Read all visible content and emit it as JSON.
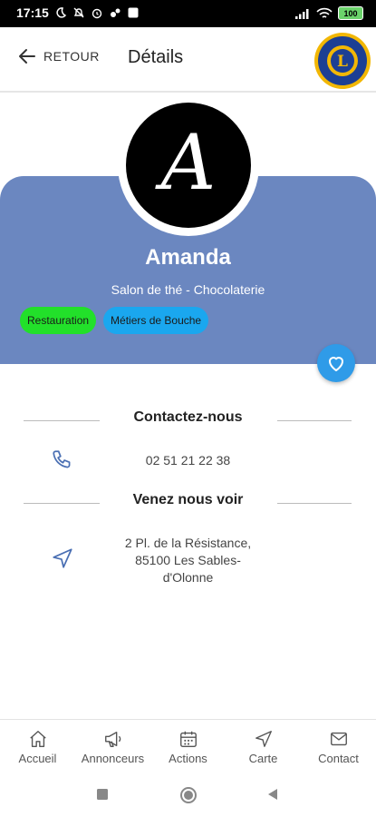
{
  "status_bar": {
    "time": "17:15",
    "battery": "100"
  },
  "header": {
    "back_label": "RETOUR",
    "title": "Détails"
  },
  "profile": {
    "avatar_letter": "A",
    "name": "Amanda",
    "subtitle": "Salon de thé - Chocolaterie",
    "tags": [
      {
        "label": "Restauration",
        "color": "#22e02a"
      },
      {
        "label": "Métiers de Bouche",
        "color": "#1aa7ef"
      }
    ]
  },
  "contact": {
    "title": "Contactez-nous",
    "phone": "02 51 21 22 38"
  },
  "visit": {
    "title": "Venez nous voir",
    "address_line1": "2 Pl. de la Résistance,",
    "address_line2": "85100 Les Sables-",
    "address_line3": "d'Olonne"
  },
  "nav": {
    "items": [
      {
        "label": "Accueil",
        "icon": "home-icon"
      },
      {
        "label": "Annonceurs",
        "icon": "megaphone-icon"
      },
      {
        "label": "Actions",
        "icon": "calendar-icon"
      },
      {
        "label": "Carte",
        "icon": "navigation-icon"
      },
      {
        "label": "Contact",
        "icon": "mail-icon"
      }
    ]
  },
  "colors": {
    "band": "#6b87c0",
    "accent": "#2f9be8",
    "icon": "#4a6fb3"
  }
}
